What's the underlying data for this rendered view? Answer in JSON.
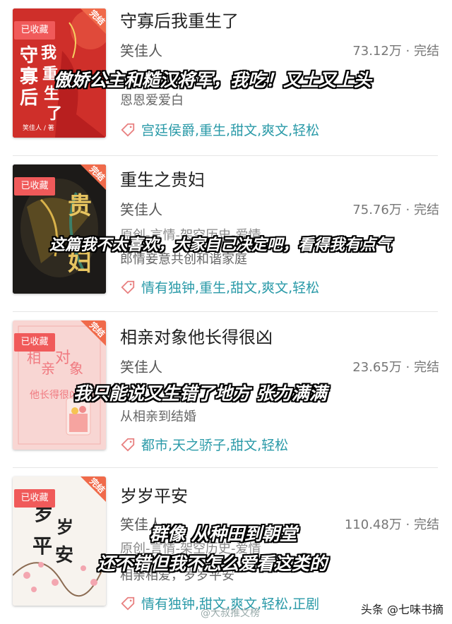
{
  "badge_label": "已收藏",
  "ribbon_label": "完结",
  "tag_icon": "tag-icon",
  "books": [
    {
      "title": "守寡后我重生了",
      "author": "笑佳人",
      "stats": "73.12万 · 完结",
      "line3": "",
      "line4": "恩恩爱爱白",
      "tags": "宫廷侯爵,重生,甜文,爽文,轻松",
      "caption": "傲娇公主和糙汉将军，我吃！又土又上头",
      "cover_title": "守寡后我重生了",
      "cover_author": "笑佳人 / 著"
    },
    {
      "title": "重生之贵妇",
      "author": "笑佳人",
      "stats": "75.76万 · 完结",
      "line3": "原创-言情-架空历史-爱情",
      "line4": "郎情妾意共创和谐家庭",
      "tags": "情有独钟,重生,甜文,爽文,轻松",
      "caption": "这篇我不太喜欢，大家自己决定吧，看得我有点气",
      "cover_title": "贵妇"
    },
    {
      "title": "相亲对象他长得很凶",
      "author": "笑佳人",
      "stats": "23.65万 · 完结",
      "line3": "",
      "line4": "从相亲到结婚",
      "tags": "都市,天之骄子,甜文,轻松",
      "caption": "我只能说又生错了地方 张力满满",
      "cover_title": "相亲对象他长得很凶"
    },
    {
      "title": "岁岁平安",
      "author": "笑佳人",
      "stats": "110.48万 · 完结",
      "line3": "原创-言情-架空历史-爱情",
      "line4": "相亲相爱，岁岁平安",
      "tags": "情有独钟,甜文,爽文,轻松,正剧",
      "caption": "群像 从种田到朝堂",
      "caption2": "还不错但我不怎么爱看这类的",
      "cover_title": "岁岁平安"
    }
  ],
  "watermark_left": "@大叔推文榜",
  "watermark_right": "头条 @七味书摘"
}
